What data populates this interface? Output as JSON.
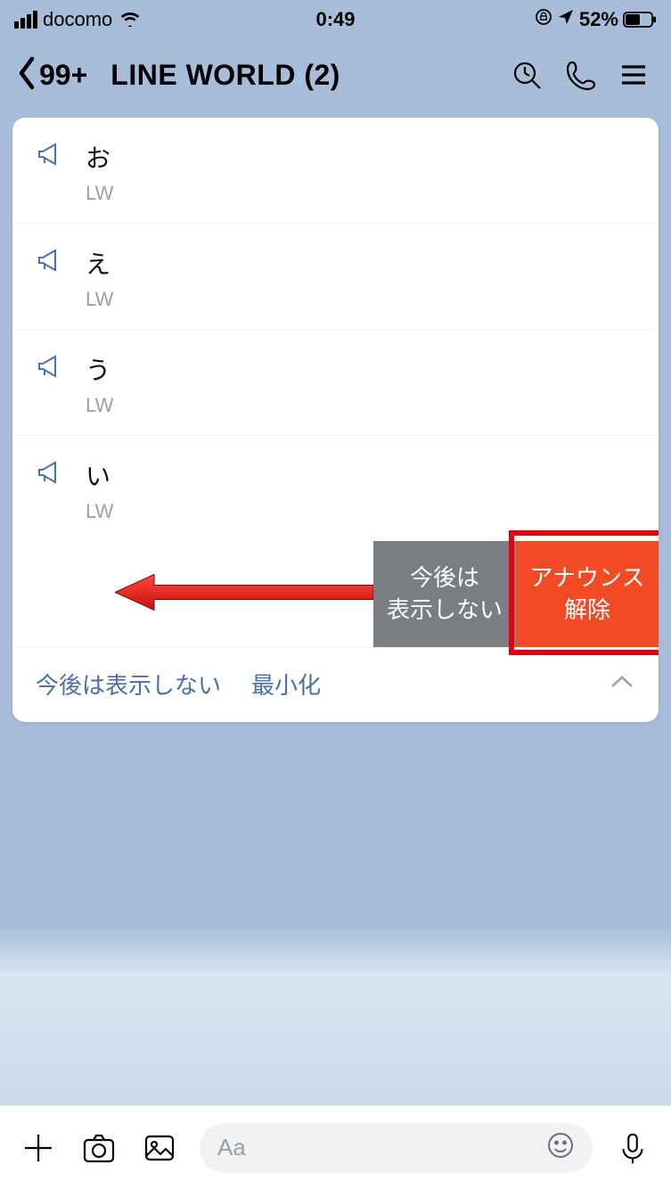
{
  "status": {
    "carrier": "docomo",
    "time": "0:49",
    "battery_percent": "52%"
  },
  "header": {
    "back_badge": "99+",
    "title": "LINE  WORLD (2)"
  },
  "announcements": [
    {
      "message": "お",
      "sender": "LW"
    },
    {
      "message": "え",
      "sender": "LW"
    },
    {
      "message": "う",
      "sender": "LW"
    },
    {
      "message": "い",
      "sender": "LW"
    }
  ],
  "swipe": {
    "hide_label": "今後は\n表示しない",
    "unannounce_label": "アナウンス\n解除"
  },
  "footer": {
    "hide_label": "今後は表示しない",
    "minimize_label": "最小化"
  },
  "input": {
    "placeholder": "Aa"
  }
}
